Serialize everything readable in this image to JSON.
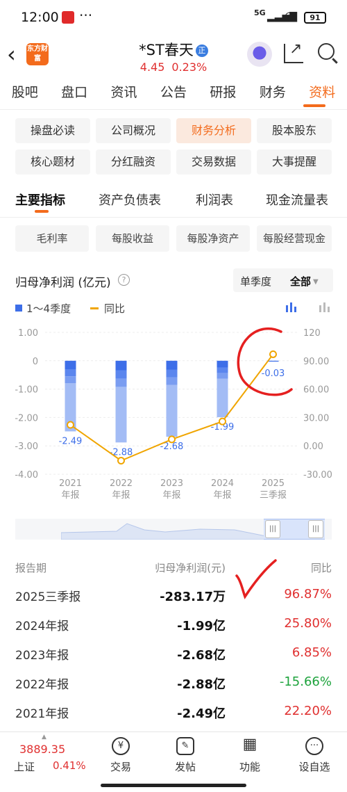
{
  "status": {
    "time": "12:00",
    "dots": "···",
    "network": "5G",
    "battery": "91"
  },
  "header": {
    "logo_text": "东方财富",
    "stock_name": "*ST春天",
    "badge": "正",
    "price": "4.45",
    "change_pct": "0.23%"
  },
  "main_tabs": [
    "股吧",
    "盘口",
    "资讯",
    "公告",
    "研报",
    "财务",
    "资料"
  ],
  "pills": [
    [
      "操盘必读",
      "公司概况",
      "财务分析",
      "股本股东"
    ],
    [
      "核心题材",
      "分红融资",
      "交易数据",
      "大事提醒"
    ]
  ],
  "sub_tabs": [
    "主要指标",
    "资产负债表",
    "利润表",
    "现金流量表"
  ],
  "metrics": [
    "毛利率",
    "每股收益",
    "每股净资产",
    "每股经营现金"
  ],
  "chart_header": {
    "title": "归母净利润 (亿元)",
    "help": "?",
    "seg_quarter": "单季度",
    "seg_all": "全部",
    "caret": "▼",
    "legend_bar": "1～4季度",
    "legend_line": "同比"
  },
  "chart_data": {
    "type": "bar",
    "categories": [
      "2021 年报",
      "2022 年报",
      "2023 年报",
      "2024 年报",
      "2025 三季报"
    ],
    "x_labels_line1": [
      "2021",
      "2022",
      "2023",
      "2024",
      "2025"
    ],
    "x_labels_line2": [
      "年报",
      "年报",
      "年报",
      "年报",
      "三季报"
    ],
    "series": [
      {
        "name": "1～4季度",
        "values": [
          -2.49,
          -2.88,
          -2.68,
          -1.99,
          -0.03
        ]
      },
      {
        "name": "同比",
        "values": [
          22.2,
          -15.66,
          6.85,
          25.8,
          96.87
        ]
      }
    ],
    "data_labels": [
      "-2.49",
      "-2.88",
      "-2.68",
      "-1.99",
      "-0.03"
    ],
    "y_left_ticks": [
      "1.00",
      "0",
      "-1.00",
      "-2.00",
      "-3.00",
      "-4.00"
    ],
    "y_left_range": [
      -4,
      1
    ],
    "y_right_ticks": [
      "120",
      "90.00",
      "60.00",
      "30.00",
      "0.00",
      "-30.00"
    ],
    "y_right_range": [
      -30,
      120
    ],
    "colors": {
      "bar": "#3d6ee8",
      "bar_light": "#a3bcf5",
      "line": "#f0a500"
    }
  },
  "table": {
    "headers": [
      "报告期",
      "归母净利润(元)",
      "同比"
    ],
    "rows": [
      {
        "period": "2025三季报",
        "value": "-283.17万",
        "yoy": "96.87%",
        "dir": "up"
      },
      {
        "period": "2024年报",
        "value": "-1.99亿",
        "yoy": "25.80%",
        "dir": "up"
      },
      {
        "period": "2023年报",
        "value": "-2.68亿",
        "yoy": "6.85%",
        "dir": "up"
      },
      {
        "period": "2022年报",
        "value": "-2.88亿",
        "yoy": "-15.66%",
        "dir": "down"
      },
      {
        "period": "2021年报",
        "value": "-2.49亿",
        "yoy": "22.20%",
        "dir": "up"
      }
    ]
  },
  "bottom_bar": {
    "index_value": "3889.35",
    "index_name": "上证",
    "index_change": "0.41%",
    "items": [
      {
        "label": "交易",
        "icon": "¥"
      },
      {
        "label": "发帖",
        "icon": "✎"
      },
      {
        "label": "功能",
        "icon": "▦"
      },
      {
        "label": "设自选",
        "icon": "···"
      }
    ]
  }
}
